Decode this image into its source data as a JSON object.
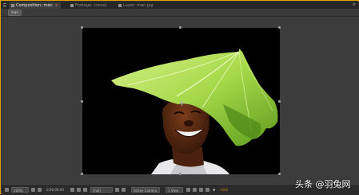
{
  "tabs": [
    {
      "label": "Composition: man"
    },
    {
      "label": "Footage: (none)"
    },
    {
      "label": "Layer: man.jpg"
    }
  ],
  "breadcrumb": {
    "label": "man"
  },
  "footer": {
    "zoom": "100%",
    "timecode": "0;00;00;00",
    "resolution": "(Full)",
    "camera": "Active Camera",
    "views": "1 View",
    "exposure": "+0.0"
  },
  "watermark": {
    "text": "头条 @羽兔网"
  },
  "colors": {
    "panel_border": "#e0a000",
    "viewer_bg": "#3c3c3c",
    "accent": "#e8a000"
  }
}
